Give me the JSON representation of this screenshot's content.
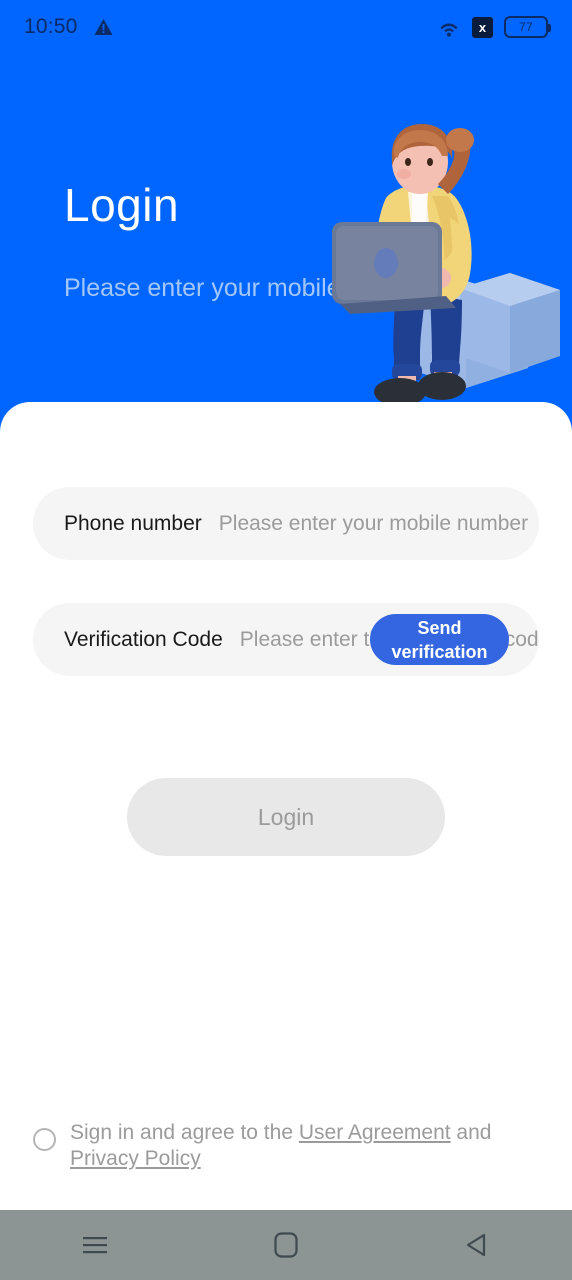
{
  "status_bar": {
    "time": "10:50",
    "warning_icon": "warning-triangle-icon",
    "wifi_icon": "wifi-icon",
    "sim_icon_label": "x",
    "battery_level": "77"
  },
  "header": {
    "title": "Login",
    "subtitle": "Please enter your mobile number",
    "background_color": "#0066ff",
    "illustration": "person-with-laptop-illustration"
  },
  "form": {
    "phone_field": {
      "label": "Phone number",
      "placeholder": "Please enter your mobile number",
      "value": ""
    },
    "code_field": {
      "label": "Verification Code",
      "placeholder": "Please enter the verification code",
      "value": "",
      "send_button_label": "Send verification code",
      "send_button_color": "#3366e0"
    },
    "login_button": {
      "label": "Login",
      "background_color": "#e8e8e8",
      "text_color": "#9b9b9b"
    }
  },
  "agreement": {
    "checked": false,
    "prefix": "Sign in and agree to the ",
    "user_agreement": "User Agreement",
    "conjunction": " and ",
    "privacy_policy": "Privacy Policy"
  },
  "nav_bar": {
    "recents_icon": "menu-icon",
    "home_icon": "home-square-icon",
    "back_icon": "back-triangle-icon",
    "background_color": "#8d9594"
  }
}
